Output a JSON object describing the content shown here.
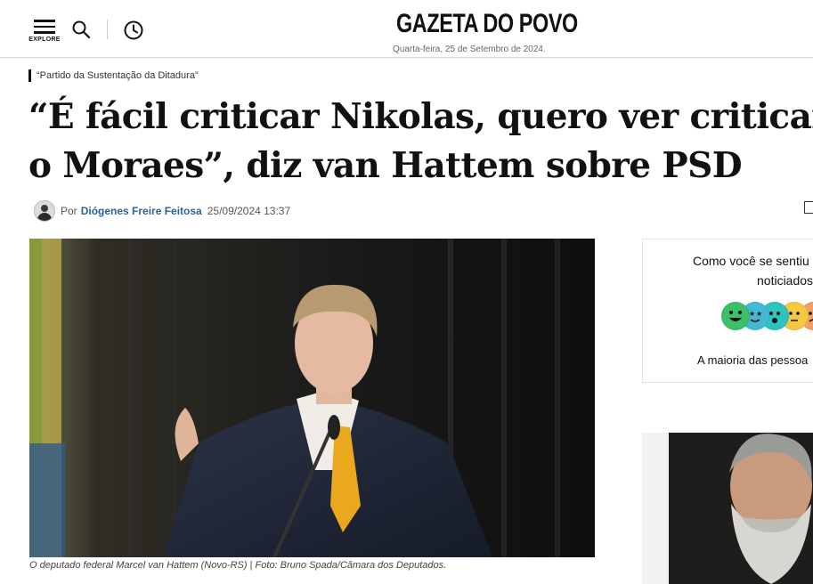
{
  "header": {
    "explore_label": "EXPLORE",
    "logo": "GAZETA DO POVO",
    "date": "Quarta-feira, 25 de Setembro de 2024."
  },
  "article": {
    "kicker": "“Partido da Sustentação da Ditadura”",
    "headline_line1": "“É fácil criticar Nikolas, quero ver criticar",
    "headline_line2": "o Moraes”, diz van Hattem sobre PSD",
    "byline_prefix": "Por",
    "author": "Diógenes Freire Feitosa",
    "datetime": "25/09/2024 13:37",
    "photo_caption": "O deputado federal Marcel van Hattem (Novo-RS)",
    "photo_credit": "Foto: Bruno Spada/Câmara dos Deputados."
  },
  "reaction_widget": {
    "question_line1": "Como você se sentiu",
    "question_line2": "noticiados",
    "footer": "A maioria das pessoa",
    "emoji_colors": [
      "#3dbf6a",
      "#45b8d6",
      "#2fc3c0",
      "#f5c842",
      "#f0a066"
    ]
  }
}
